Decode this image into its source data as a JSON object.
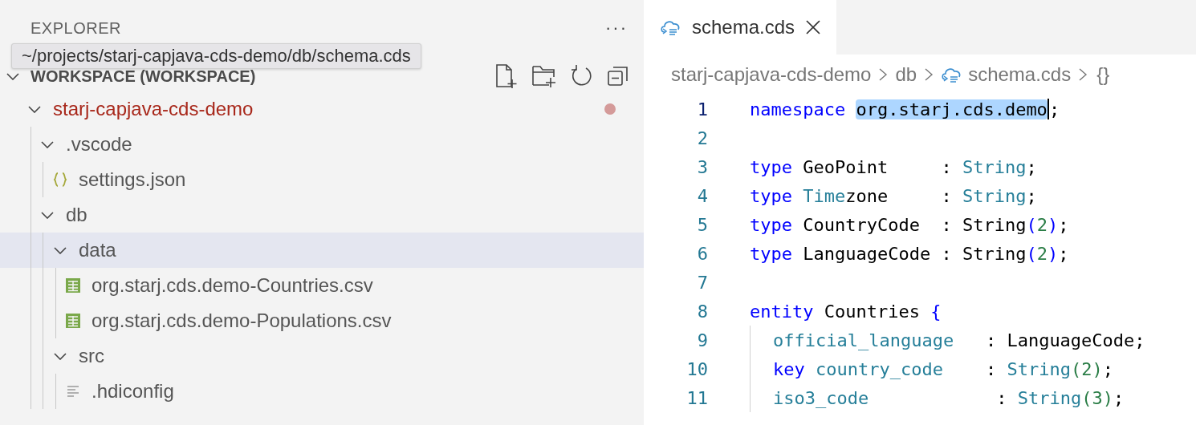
{
  "sidebar": {
    "title": "EXPLORER",
    "more": "···",
    "tooltip": "~/projects/starj-capjava-cds-demo/db/schema.cds",
    "workspace": {
      "label": "WORKSPACE (WORKSPACE)",
      "expanded": true
    },
    "tree": [
      {
        "label": "starj-capjava-cds-demo",
        "kind": "folder",
        "expanded": true,
        "selected": false,
        "modified": true,
        "children": [
          {
            "label": ".vscode",
            "kind": "folder",
            "expanded": true,
            "selected": false,
            "children": [
              {
                "label": "settings.json",
                "kind": "json",
                "selected": false
              }
            ]
          },
          {
            "label": "db",
            "kind": "folder",
            "expanded": true,
            "selected": false,
            "children": [
              {
                "label": "data",
                "kind": "folder",
                "expanded": true,
                "selected": true,
                "children": [
                  {
                    "label": "org.starj.cds.demo-Countries.csv",
                    "kind": "csv",
                    "selected": false
                  },
                  {
                    "label": "org.starj.cds.demo-Populations.csv",
                    "kind": "csv",
                    "selected": false
                  }
                ]
              },
              {
                "label": "src",
                "kind": "folder",
                "expanded": true,
                "selected": false,
                "children": [
                  {
                    "label": ".hdiconfig",
                    "kind": "text",
                    "selected": false
                  }
                ]
              }
            ]
          }
        ]
      }
    ]
  },
  "editor": {
    "tabs": [
      {
        "label": "schema.cds",
        "selected": true
      }
    ],
    "breadcrumb": [
      {
        "label": "starj-capjava-cds-demo",
        "kind": "folder"
      },
      {
        "label": "db",
        "kind": "folder"
      },
      {
        "label": "schema.cds",
        "kind": "cds"
      },
      {
        "label": "{}",
        "kind": "symbol"
      }
    ],
    "lines": [
      {
        "number": "1",
        "active": true,
        "tokens": [
          {
            "text": "namespace ",
            "kind": "keyword"
          },
          {
            "text": "org.starj.cds.demo",
            "kind": "selected"
          },
          {
            "text": ";",
            "kind": "text"
          }
        ]
      },
      {
        "number": "2",
        "active": false
      },
      {
        "number": "3",
        "active": false,
        "tokens": [
          {
            "text": "type ",
            "kind": "keyword"
          },
          {
            "text": "GeoPoint     : ",
            "kind": "text"
          },
          {
            "text": "String",
            "kind": "type"
          },
          {
            "text": ";",
            "kind": "text"
          }
        ]
      },
      {
        "number": "4",
        "active": false,
        "tokens": [
          {
            "text": "type ",
            "kind": "keyword"
          },
          {
            "text": "Time",
            "kind": "type"
          },
          {
            "text": "zone     : ",
            "kind": "text"
          },
          {
            "text": "String",
            "kind": "type"
          },
          {
            "text": ";",
            "kind": "text"
          }
        ]
      },
      {
        "number": "5",
        "active": false,
        "tokens": [
          {
            "text": "type ",
            "kind": "keyword"
          },
          {
            "text": "CountryCode  : String",
            "kind": "text"
          },
          {
            "text": "(",
            "kind": "bracket"
          },
          {
            "text": "2",
            "kind": "number"
          },
          {
            "text": ")",
            "kind": "bracket"
          },
          {
            "text": ";",
            "kind": "text"
          }
        ]
      },
      {
        "number": "6",
        "active": false,
        "tokens": [
          {
            "text": "type ",
            "kind": "keyword"
          },
          {
            "text": "LanguageCode : String",
            "kind": "text"
          },
          {
            "text": "(",
            "kind": "bracket"
          },
          {
            "text": "2",
            "kind": "number"
          },
          {
            "text": ")",
            "kind": "bracket"
          },
          {
            "text": ";",
            "kind": "text"
          }
        ]
      },
      {
        "number": "7",
        "active": false
      },
      {
        "number": "8",
        "active": false,
        "tokens": [
          {
            "text": "entity ",
            "kind": "keyword"
          },
          {
            "text": "Countries ",
            "kind": "text"
          },
          {
            "text": "{",
            "kind": "bracket"
          }
        ]
      },
      {
        "number": "9",
        "active": false,
        "guide": true,
        "tokens": [
          {
            "text": "official_language",
            "kind": "field"
          },
          {
            "text": "   : LanguageCode;",
            "kind": "text"
          }
        ]
      },
      {
        "number": "10",
        "active": false,
        "guide": true,
        "tokens": [
          {
            "text": "key ",
            "kind": "keyword"
          },
          {
            "text": "country_code",
            "kind": "field"
          },
          {
            "text": "    : ",
            "kind": "text"
          },
          {
            "text": "String",
            "kind": "type"
          },
          {
            "text": "(",
            "kind": "bracket2"
          },
          {
            "text": "2",
            "kind": "number"
          },
          {
            "text": ")",
            "kind": "bracket2"
          },
          {
            "text": ";",
            "kind": "text"
          }
        ]
      },
      {
        "number": "11",
        "active": false,
        "guide": true,
        "tokens": [
          {
            "text": "iso3_code",
            "kind": "field"
          },
          {
            "text": "            : ",
            "kind": "text"
          },
          {
            "text": "String",
            "kind": "type"
          },
          {
            "text": "(",
            "kind": "bracket2"
          },
          {
            "text": "3",
            "kind": "number"
          },
          {
            "text": ")",
            "kind": "bracket2"
          },
          {
            "text": ";",
            "kind": "text"
          }
        ]
      }
    ]
  }
}
